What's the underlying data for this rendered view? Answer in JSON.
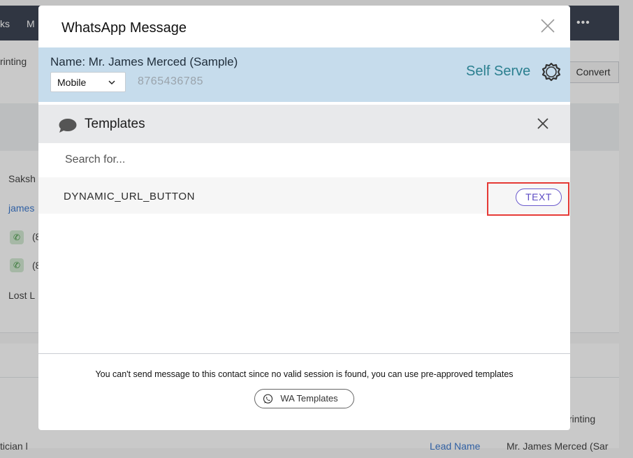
{
  "background": {
    "nav_left": "ks",
    "nav_left2": "M",
    "more": "•••",
    "crumb": "rinting",
    "convert_button": "Convert",
    "contact_first": "Saksh",
    "contact_email": "james",
    "phone1": "(8",
    "phone2": "(8",
    "status": "Lost L",
    "bottom_left": "tician l",
    "right_field_value": "rinting",
    "lead_name_label": "Lead Name",
    "lead_name_value": "Mr. James Merced (Sar"
  },
  "modal": {
    "title": "WhatsApp Message",
    "contact": {
      "name": "Name: Mr. James Merced (Sample)",
      "phone_type": "Mobile",
      "phone_number": "8765436785",
      "self_serve_label": "Self Serve"
    },
    "templates": {
      "title": "Templates",
      "search_placeholder": "Search for...",
      "items": [
        {
          "name": "DYNAMIC_URL_BUTTON",
          "type": "TEXT"
        }
      ]
    },
    "footer": {
      "message": "You can't send message to this contact since no valid session is found, you can use pre-approved templates",
      "wa_templates_label": "WA Templates"
    }
  },
  "colors": {
    "accent": "#2a7f8f",
    "contact_bar": "#c6dcec",
    "badge": "#5b4bc4",
    "highlight": "#e53935"
  }
}
